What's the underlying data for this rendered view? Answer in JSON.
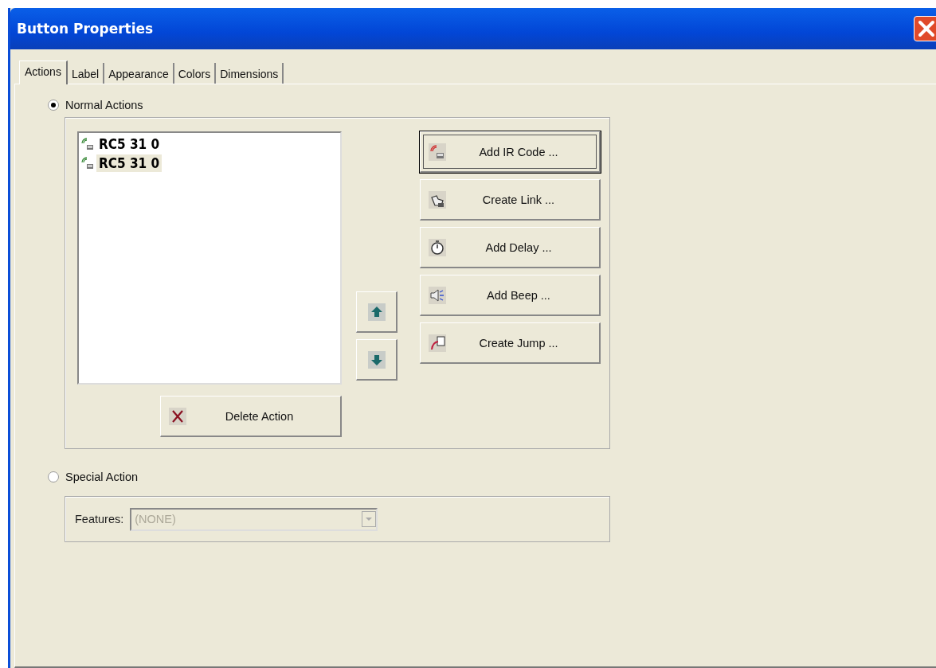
{
  "window": {
    "title": "Button Properties"
  },
  "tabs": [
    {
      "label": "Actions",
      "selected": true
    },
    {
      "label": "Label",
      "selected": false
    },
    {
      "label": "Appearance",
      "selected": false
    },
    {
      "label": "Colors",
      "selected": false
    },
    {
      "label": "Dimensions",
      "selected": false
    }
  ],
  "normal_actions": {
    "label": "Normal Actions",
    "selected": true
  },
  "actions": [
    {
      "label": "RC5 31 0",
      "selected": false
    },
    {
      "label": "RC5 31 0",
      "selected": true
    }
  ],
  "action_buttons": [
    {
      "label": "Add IR Code ...",
      "kind": "ir",
      "focused": true
    },
    {
      "label": "Create Link ...",
      "kind": "link",
      "focused": false
    },
    {
      "label": "Add Delay ...",
      "kind": "delay",
      "focused": false
    },
    {
      "label": "Add Beep ...",
      "kind": "beep",
      "focused": false
    },
    {
      "label": "Create Jump ...",
      "kind": "jump",
      "focused": false
    }
  ],
  "delete_button": {
    "label": "Delete Action"
  },
  "special_action": {
    "label": "Special Action",
    "selected": false
  },
  "features": {
    "label": "Features:",
    "value": "(NONE)",
    "disabled": true
  }
}
